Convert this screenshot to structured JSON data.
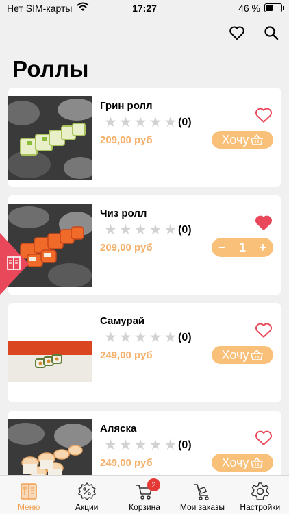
{
  "status_bar": {
    "carrier": "Нет SIM-карты",
    "time": "17:27",
    "battery_text": "46 %",
    "battery_level": 0.46
  },
  "header": {
    "icons": [
      "heart-outline-icon",
      "search-icon"
    ]
  },
  "page": {
    "title": "Роллы"
  },
  "products": [
    {
      "name": "Грин ролл",
      "rating_count": "(0)",
      "price": "209,00 руб",
      "favorite": false,
      "in_cart": false,
      "button_label": "Хочу"
    },
    {
      "name": "Чиз ролл",
      "rating_count": "(0)",
      "price": "209,00 руб",
      "favorite": true,
      "in_cart": true,
      "quantity": "1",
      "minus": "−",
      "plus": "+"
    },
    {
      "name": "Самурай",
      "rating_count": "(0)",
      "price": "249,00 руб",
      "favorite": false,
      "in_cart": false,
      "button_label": "Хочу"
    },
    {
      "name": "Аляска",
      "rating_count": "(0)",
      "price": "249,00 руб",
      "favorite": false,
      "in_cart": false,
      "button_label": "Хочу"
    }
  ],
  "side_tab": {
    "icon": "book-menu-icon",
    "color": "#e8485a"
  },
  "tabs": [
    {
      "label": "Меню",
      "icon": "menu-book-icon",
      "active": true
    },
    {
      "label": "Акции",
      "icon": "discount-badge-icon",
      "active": false
    },
    {
      "label": "Корзина",
      "icon": "cart-icon",
      "active": false,
      "badge": "2"
    },
    {
      "label": "Мои заказы",
      "icon": "orders-cart-icon",
      "active": false
    },
    {
      "label": "Настройки",
      "icon": "gear-icon",
      "active": false
    }
  ],
  "colors": {
    "accent": "#f9c079",
    "price": "#f5b06a",
    "favorite": "#e8485a",
    "badge": "#e53935",
    "active_tab": "#f2a053"
  }
}
